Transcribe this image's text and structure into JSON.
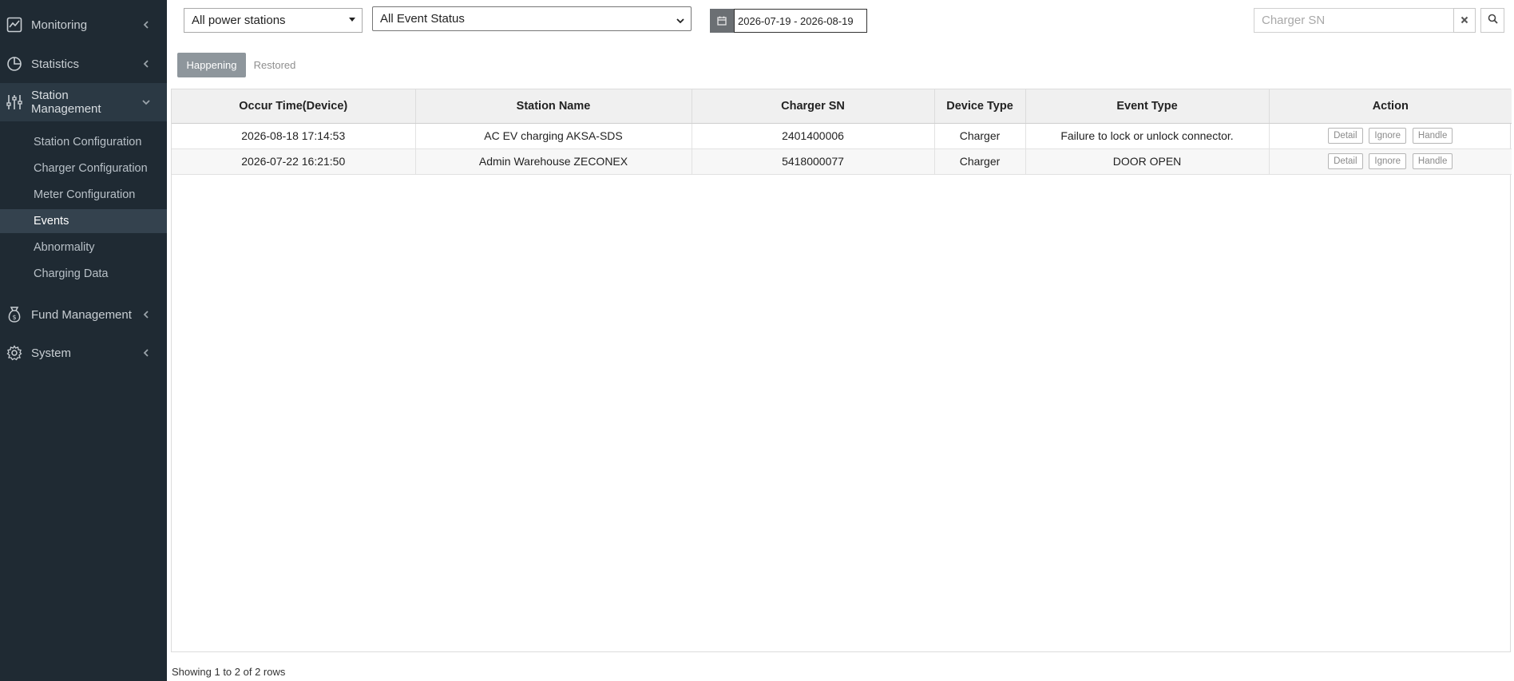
{
  "sidebar": {
    "items": [
      {
        "label": "Monitoring",
        "icon": "monitor-chart-icon"
      },
      {
        "label": "Statistics",
        "icon": "pie-chart-icon"
      },
      {
        "label": "Station Management",
        "icon": "sliders-icon"
      },
      {
        "label": "Fund Management",
        "icon": "money-bag-icon"
      },
      {
        "label": "System",
        "icon": "gear-icon"
      }
    ],
    "sub_items": [
      {
        "label": "Station Configuration"
      },
      {
        "label": "Charger Configuration"
      },
      {
        "label": "Meter Configuration"
      },
      {
        "label": "Events"
      },
      {
        "label": "Abnormality"
      },
      {
        "label": "Charging Data"
      }
    ],
    "active_sub_item": "Events",
    "colors": {
      "background": "#1f2a33",
      "active": "#34424e"
    }
  },
  "filters": {
    "power_station": "All power stations",
    "event_status": "All Event Status",
    "date_range": "2026-07-19 - 2026-08-19",
    "charger_sn_placeholder": "Charger SN"
  },
  "tabs": [
    {
      "label": "Happening",
      "active": true
    },
    {
      "label": "Restored",
      "active": false
    }
  ],
  "table": {
    "columns": [
      "Occur Time(Device)",
      "Station Name",
      "Charger SN",
      "Device Type",
      "Event Type",
      "Action"
    ],
    "rows": [
      {
        "occur_time": "2026-08-18 17:14:53",
        "station_name": "AC EV charging AKSA-SDS",
        "charger_sn": "2401400006",
        "device_type": "Charger",
        "event_type": "Failure to lock or unlock connector."
      },
      {
        "occur_time": "2026-07-22 16:21:50",
        "station_name": "Admin Warehouse ZECONEX",
        "charger_sn": "5418000077",
        "device_type": "Charger",
        "event_type": "DOOR OPEN"
      }
    ],
    "actions": [
      "Detail",
      "Ignore",
      "Handle"
    ]
  },
  "footer": {
    "summary": "Showing 1 to 2 of 2 rows"
  }
}
